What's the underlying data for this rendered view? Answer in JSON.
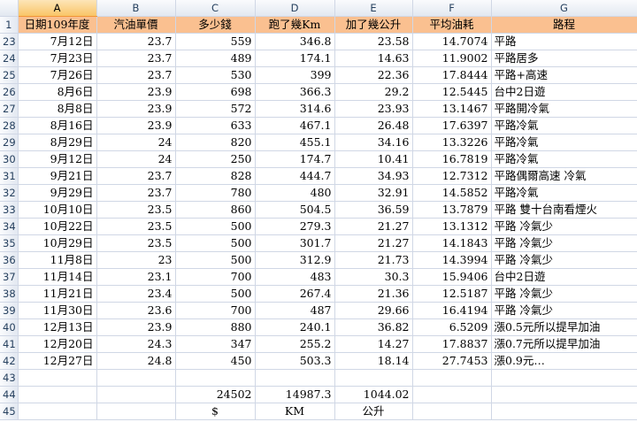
{
  "columns": [
    "A",
    "B",
    "C",
    "D",
    "E",
    "F",
    "G"
  ],
  "header_row": {
    "row_num": "1",
    "cells": [
      "日期109年度",
      "汽油單價",
      "多少錢",
      "跑了幾Km",
      "加了幾公升",
      "平均油耗",
      "路程"
    ]
  },
  "rows": [
    {
      "n": "23",
      "date": "7月12日",
      "price": "23.7",
      "cost": "559",
      "km": "346.8",
      "liters": "23.58",
      "avg": "14.7074",
      "route": "平路"
    },
    {
      "n": "24",
      "date": "7月23日",
      "price": "23.7",
      "cost": "489",
      "km": "174.1",
      "liters": "14.63",
      "avg": "11.9002",
      "route": "平路居多"
    },
    {
      "n": "25",
      "date": "7月26日",
      "price": "23.7",
      "cost": "530",
      "km": "399",
      "liters": "22.36",
      "avg": "17.8444",
      "route": "平路+高速"
    },
    {
      "n": "26",
      "date": "8月6日",
      "price": "23.9",
      "cost": "698",
      "km": "366.3",
      "liters": "29.2",
      "avg": "12.5445",
      "route": "台中2日遊"
    },
    {
      "n": "27",
      "date": "8月8日",
      "price": "23.9",
      "cost": "572",
      "km": "314.6",
      "liters": "23.93",
      "avg": "13.1467",
      "route": "平路開冷氣"
    },
    {
      "n": "28",
      "date": "8月16日",
      "price": "23.9",
      "cost": "633",
      "km": "467.1",
      "liters": "26.48",
      "avg": "17.6397",
      "route": "平路冷氣"
    },
    {
      "n": "29",
      "date": "8月29日",
      "price": "24",
      "cost": "820",
      "km": "455.1",
      "liters": "34.16",
      "avg": "13.3226",
      "route": "平路冷氣"
    },
    {
      "n": "30",
      "date": "9月12日",
      "price": "24",
      "cost": "250",
      "km": "174.7",
      "liters": "10.41",
      "avg": "16.7819",
      "route": "平路冷氣"
    },
    {
      "n": "31",
      "date": "9月21日",
      "price": "23.7",
      "cost": "828",
      "km": "444.7",
      "liters": "34.93",
      "avg": "12.7312",
      "route": "平路偶爾高速 冷氣"
    },
    {
      "n": "32",
      "date": "9月29日",
      "price": "23.7",
      "cost": "780",
      "km": "480",
      "liters": "32.91",
      "avg": "14.5852",
      "route": "平路冷氣"
    },
    {
      "n": "33",
      "date": "10月10日",
      "price": "23.5",
      "cost": "860",
      "km": "504.5",
      "liters": "36.59",
      "avg": "13.7879",
      "route": "平路 雙十台南看煙火"
    },
    {
      "n": "34",
      "date": "10月22日",
      "price": "23.5",
      "cost": "500",
      "km": "279.3",
      "liters": "21.27",
      "avg": "13.1312",
      "route": "平路 冷氣少"
    },
    {
      "n": "35",
      "date": "10月29日",
      "price": "23.5",
      "cost": "500",
      "km": "301.7",
      "liters": "21.27",
      "avg": "14.1843",
      "route": "平路 冷氣少"
    },
    {
      "n": "36",
      "date": "11月8日",
      "price": "23",
      "cost": "500",
      "km": "312.9",
      "liters": "21.73",
      "avg": "14.3994",
      "route": "平路 冷氣少"
    },
    {
      "n": "37",
      "date": "11月14日",
      "price": "23.1",
      "cost": "700",
      "km": "483",
      "liters": "30.3",
      "avg": "15.9406",
      "route": "台中2日遊"
    },
    {
      "n": "38",
      "date": "11月21日",
      "price": "23.4",
      "cost": "500",
      "km": "267.4",
      "liters": "21.36",
      "avg": "12.5187",
      "route": "平路 冷氣少"
    },
    {
      "n": "39",
      "date": "11月30日",
      "price": "23.6",
      "cost": "700",
      "km": "487",
      "liters": "29.66",
      "avg": "16.4194",
      "route": "平路 冷氣少"
    },
    {
      "n": "40",
      "date": "12月13日",
      "price": "23.9",
      "cost": "880",
      "km": "240.1",
      "liters": "36.82",
      "avg": "6.5209",
      "route": "漲0.5元所以提早加油"
    },
    {
      "n": "41",
      "date": "12月20日",
      "price": "24.3",
      "cost": "347",
      "km": "255.2",
      "liters": "14.27",
      "avg": "17.8837",
      "route": "漲0.7元所以提早加油"
    },
    {
      "n": "42",
      "date": "12月27日",
      "price": "24.8",
      "cost": "450",
      "km": "503.3",
      "liters": "18.14",
      "avg": "27.7453",
      "route": "漲0.9元…"
    }
  ],
  "row43": {
    "n": "43"
  },
  "totals_row": {
    "n": "44",
    "cost": "24502",
    "km": "14987.3",
    "liters": "1044.02"
  },
  "units_row": {
    "n": "45",
    "cost": "$",
    "km": "KM",
    "liters": "公升"
  }
}
